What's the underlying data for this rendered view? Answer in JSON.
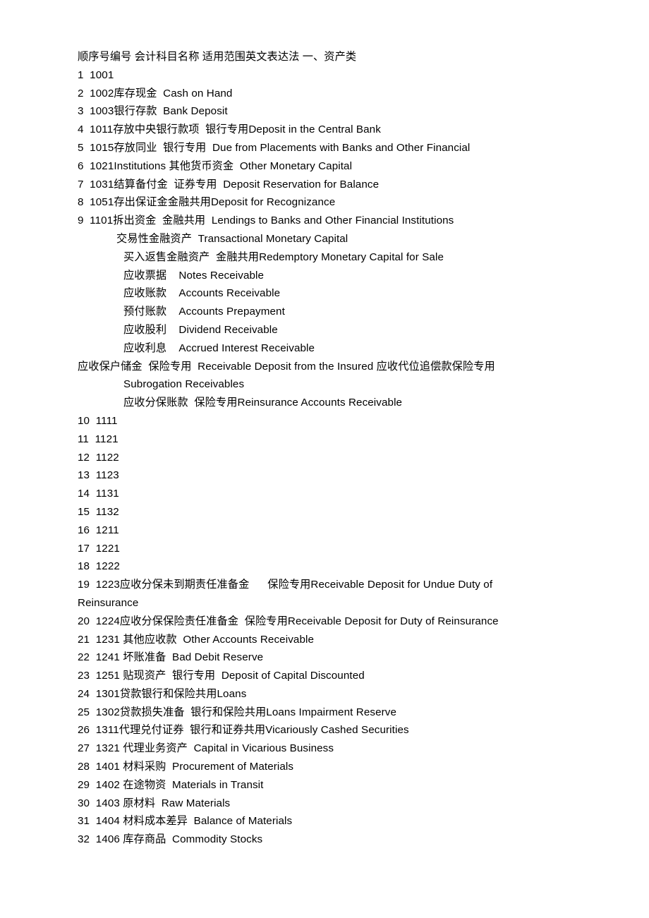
{
  "document": {
    "header": "顺序号编号 会计科目名称 适用范围英文表达法 一、资产类",
    "section_label": "一、资产类",
    "columns": [
      "顺序号",
      "编号",
      "会计科目名称",
      "适用范围",
      "英文表达法"
    ],
    "rows": [
      {
        "no": "1",
        "text": "1  1001"
      },
      {
        "no": "2",
        "text": "2  1002库存现金  Cash on Hand"
      },
      {
        "no": "3",
        "text": "3  1003银行存款  Bank Deposit"
      },
      {
        "no": "4",
        "text": "4  1011存放中央银行款项  银行专用Deposit in the Central Bank"
      },
      {
        "no": "5",
        "text": "5  1015存放同业  银行专用  Due from Placements with Banks and Other Financial"
      },
      {
        "no": "6",
        "text": "6  1021Institutions 其他货币资金  Other Monetary Capital"
      },
      {
        "no": "7",
        "text": "7  1031结算备付金  证券专用  Deposit Reservation for Balance"
      },
      {
        "no": "8",
        "text": "8  1051存出保证金金融共用Deposit for Recognizance"
      },
      {
        "no": "9",
        "text": "9  1101拆出资金  金融共用  Lendings to Banks and Other Financial Institutions"
      },
      {
        "no": "",
        "text": "交易性金融资产  Transactional Monetary Capital",
        "indent": "a"
      },
      {
        "no": "",
        "text": "买入返售金融资产  金融共用Redemptory Monetary Capital for Sale",
        "indent": "b"
      },
      {
        "no": "",
        "text": "应收票据    Notes Receivable",
        "indent": "b"
      },
      {
        "no": "",
        "text": "应收账款    Accounts Receivable",
        "indent": "b"
      },
      {
        "no": "",
        "text": "预付账款    Accounts Prepayment",
        "indent": "b"
      },
      {
        "no": "",
        "text": "应收股利    Dividend Receivable",
        "indent": "b"
      },
      {
        "no": "",
        "text": "应收利息    Accrued Interest Receivable",
        "indent": "b"
      },
      {
        "no": "",
        "text": "应收保户储金  保险专用  Receivable Deposit from the Insured 应收代位追偿款保险专用Subrogation Receivables",
        "indent": "wrapb"
      },
      {
        "no": "",
        "text": "应收分保账款  保险专用Reinsurance Accounts Receivable",
        "indent": "b"
      },
      {
        "no": "10",
        "text": "10  1111"
      },
      {
        "no": "11",
        "text": "11  1121"
      },
      {
        "no": "12",
        "text": "12  1122"
      },
      {
        "no": "13",
        "text": "13  1123"
      },
      {
        "no": "14",
        "text": "14  1131"
      },
      {
        "no": "15",
        "text": "15  1132"
      },
      {
        "no": "16",
        "text": "16  1211"
      },
      {
        "no": "17",
        "text": "17  1221"
      },
      {
        "no": "18",
        "text": "18  1222"
      },
      {
        "no": "19",
        "text": "19  1223应收分保未到期责任准备金      保险专用Receivable Deposit for Undue Duty of Reinsurance"
      },
      {
        "no": "20",
        "text": "20  1224应收分保保险责任准备金  保险专用Receivable Deposit for Duty of Reinsurance"
      },
      {
        "no": "21",
        "text": "21  1231 其他应收款  Other Accounts Receivable"
      },
      {
        "no": "22",
        "text": "22  1241 坏账准备  Bad Debit Reserve"
      },
      {
        "no": "23",
        "text": "23  1251 贴现资产  银行专用  Deposit of Capital Discounted"
      },
      {
        "no": "24",
        "text": "24  1301贷款银行和保险共用Loans"
      },
      {
        "no": "25",
        "text": "25  1302贷款损失准备  银行和保险共用Loans Impairment Reserve"
      },
      {
        "no": "26",
        "text": "26  1311代理兑付证券  银行和证券共用Vicariously Cashed Securities"
      },
      {
        "no": "27",
        "text": "27  1321 代理业务资产  Capital in Vicarious Business"
      },
      {
        "no": "28",
        "text": "28  1401 材料采购  Procurement of Materials"
      },
      {
        "no": "29",
        "text": "29  1402 在途物资  Materials in Transit"
      },
      {
        "no": "30",
        "text": "30  1403 原材料  Raw Materials"
      },
      {
        "no": "31",
        "text": "31  1404 材料成本差异  Balance of Materials"
      },
      {
        "no": "32",
        "text": "32  1406 库存商品  Commodity Stocks"
      }
    ]
  }
}
